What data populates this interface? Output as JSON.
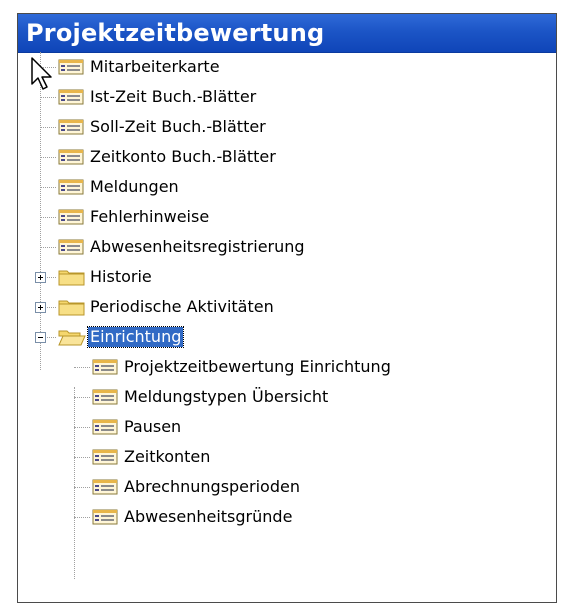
{
  "header": {
    "title": "Projektzeitbewertung"
  },
  "tree": {
    "items": [
      {
        "label": "Mitarbeiterkarte",
        "icon": "form-icon"
      },
      {
        "label": "Ist-Zeit Buch.-Blätter",
        "icon": "form-icon"
      },
      {
        "label": "Soll-Zeit Buch.-Blätter",
        "icon": "form-icon"
      },
      {
        "label": "Zeitkonto Buch.-Blätter",
        "icon": "form-icon"
      },
      {
        "label": "Meldungen",
        "icon": "form-icon"
      },
      {
        "label": "Fehlerhinweise",
        "icon": "form-icon"
      },
      {
        "label": "Abwesenheitsregistrierung",
        "icon": "form-icon"
      },
      {
        "label": "Historie",
        "icon": "folder-icon",
        "expander": "plus"
      },
      {
        "label": "Periodische Aktivitäten",
        "icon": "folder-icon",
        "expander": "plus"
      },
      {
        "label": "Einrichtung",
        "icon": "folder-open-icon",
        "expander": "minus",
        "selected": true
      },
      {
        "label": "Projektzeitbewertung Einrichtung",
        "icon": "form-icon"
      },
      {
        "label": "Meldungstypen Übersicht",
        "icon": "form-icon"
      },
      {
        "label": "Pausen",
        "icon": "form-icon"
      },
      {
        "label": "Zeitkonten",
        "icon": "form-icon"
      },
      {
        "label": "Abrechnungsperioden",
        "icon": "form-icon"
      },
      {
        "label": "Abwesenheitsgründe",
        "icon": "form-icon"
      }
    ]
  },
  "colors": {
    "header_bg": "#1c55c6",
    "selection_bg": "#316ac5",
    "folder_yellow": "#f5d76e"
  }
}
